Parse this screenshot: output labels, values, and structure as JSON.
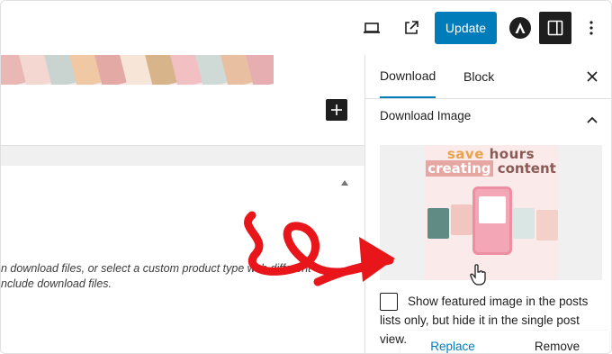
{
  "toolbar": {
    "update_label": "Update",
    "icons": [
      "laptop-icon",
      "external-link-icon",
      "astra-logo-icon",
      "sidebar-icon",
      "more-vertical-icon"
    ]
  },
  "canvas": {
    "help_text_line1": "n download files, or select a custom product type with different",
    "help_text_line2": "nclude download files."
  },
  "sidebar": {
    "tabs": [
      {
        "label": "Download",
        "active": true
      },
      {
        "label": "Block",
        "active": false
      }
    ],
    "panel_title": "Download Image",
    "image": {
      "line1_a": "save ",
      "line1_b": "hours",
      "line2_a": "creating",
      "line2_b": " content"
    },
    "replace_label": "Replace",
    "remove_label": "Remove",
    "checkbox_label": "Show featured image in the posts lists only, but hide it in the single post view."
  },
  "colors": {
    "accent": "#007cba",
    "annotation_arrow": "#e8151b",
    "dark": "#1e1e1e"
  }
}
